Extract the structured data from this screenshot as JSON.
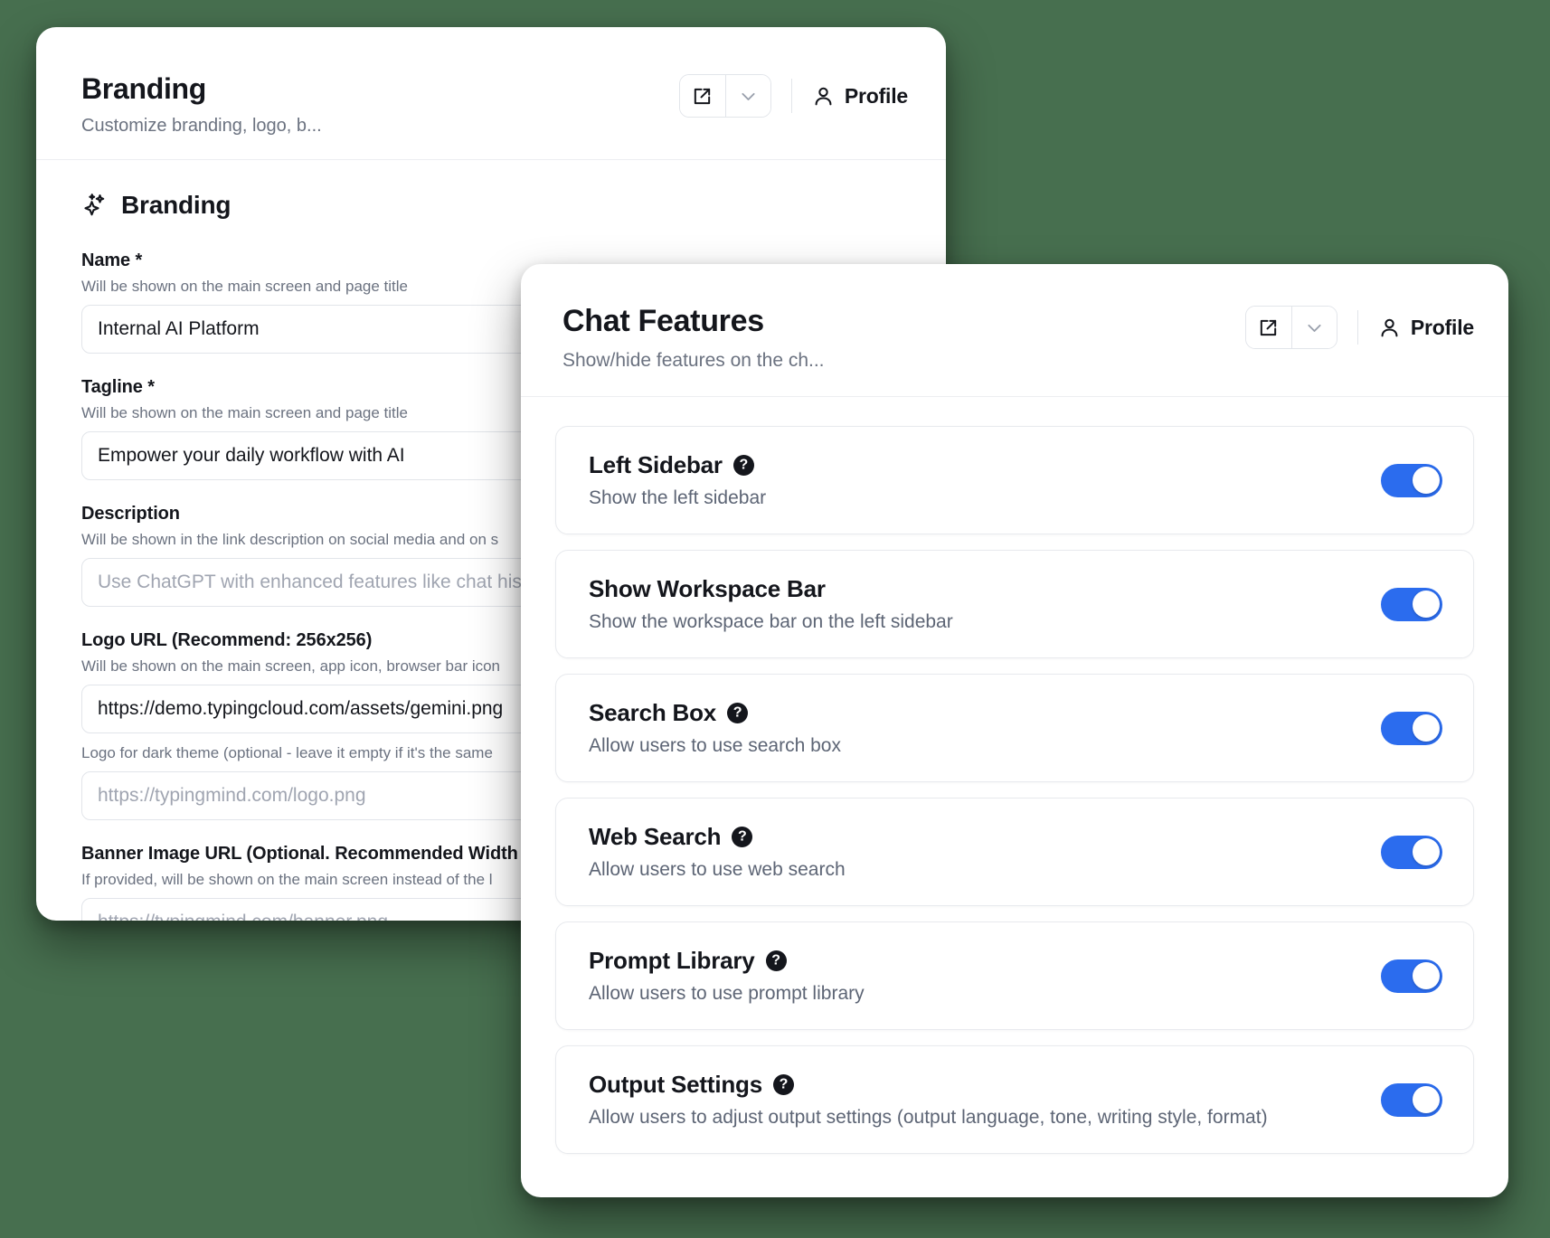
{
  "background_color": "#476F4F",
  "accent_color": "#2B6CEE",
  "branding_panel": {
    "title": "Branding",
    "subtitle": "Customize branding, logo, b...",
    "profile_label": "Profile",
    "section": {
      "icon": "sparkles-icon",
      "heading": "Branding"
    },
    "fields": [
      {
        "label": "Name *",
        "hint": "Will be shown on the main screen and page title",
        "value": "Internal AI Platform",
        "placeholder": "",
        "is_placeholder": false
      },
      {
        "label": "Tagline *",
        "hint": "Will be shown on the main screen and page title",
        "value": "Empower your daily workflow with AI",
        "placeholder": "",
        "is_placeholder": false
      },
      {
        "label": "Description",
        "hint": "Will be shown in the link description on social media and on s",
        "value": "",
        "placeholder": "Use ChatGPT with enhanced features like chat histo",
        "is_placeholder": true
      },
      {
        "label": "Logo URL (Recommend: 256x256)",
        "hint": "Will be shown on the main screen, app icon, browser bar icon",
        "value": "https://demo.typingcloud.com/assets/gemini.png",
        "placeholder": "",
        "is_placeholder": false,
        "sub_hint": "Logo for dark theme (optional - leave it empty if it's the same",
        "sub_placeholder": "https://typingmind.com/logo.png"
      },
      {
        "label": "Banner Image URL (Optional. Recommended Width",
        "hint": "If provided, will be shown on the main screen instead of the l",
        "value": "",
        "placeholder": "https://typingmind.com/banner.png",
        "is_placeholder": true
      }
    ]
  },
  "chat_features_panel": {
    "title": "Chat Features",
    "subtitle": "Show/hide features on the ch...",
    "profile_label": "Profile",
    "features": [
      {
        "title": "Left Sidebar",
        "description": "Show the left sidebar",
        "has_help": true,
        "enabled": true
      },
      {
        "title": "Show Workspace Bar",
        "description": "Show the workspace bar on the left sidebar",
        "has_help": false,
        "enabled": true
      },
      {
        "title": "Search Box",
        "description": "Allow users to use search box",
        "has_help": true,
        "enabled": true
      },
      {
        "title": "Web Search",
        "description": "Allow users to use web search",
        "has_help": true,
        "enabled": true
      },
      {
        "title": "Prompt Library",
        "description": "Allow users to use prompt library",
        "has_help": true,
        "enabled": true
      },
      {
        "title": "Output Settings",
        "description": "Allow users to adjust output settings (output language, tone, writing style, format)",
        "has_help": true,
        "enabled": true
      }
    ]
  },
  "icons": {
    "external_link": "external-link-icon",
    "chevron_down": "chevron-down-icon",
    "profile": "user-icon",
    "help": "help-circle-icon"
  }
}
